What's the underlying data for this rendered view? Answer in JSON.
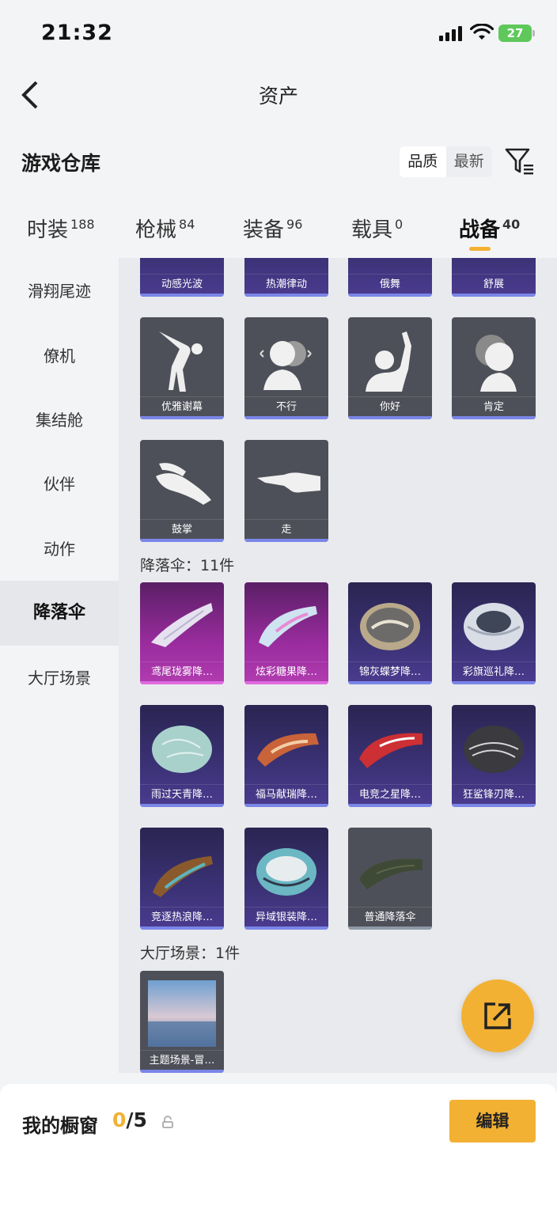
{
  "status": {
    "time": "21:32",
    "battery": "27"
  },
  "nav": {
    "title": "资产"
  },
  "section": {
    "title": "游戏仓库",
    "sort_quality": "品质",
    "sort_newest": "最新"
  },
  "tabs": [
    {
      "label": "时装",
      "count": "188"
    },
    {
      "label": "枪械",
      "count": "84"
    },
    {
      "label": "装备",
      "count": "96"
    },
    {
      "label": "载具",
      "count": "0"
    },
    {
      "label": "战备",
      "count": "40"
    }
  ],
  "sidebar": [
    "滑翔尾迹",
    "僚机",
    "集结舱",
    "伙伴",
    "动作",
    "降落伞",
    "大厅场景"
  ],
  "emotes_partial": [
    "动感光波",
    "热潮律动",
    "俄舞",
    "舒展"
  ],
  "emotes": [
    "优雅谢幕",
    "不行",
    "你好",
    "肯定",
    "鼓掌",
    "走"
  ],
  "parachute_group": {
    "title": "降落伞：11件"
  },
  "parachutes": [
    "鸢尾珑雾降…",
    "炫彩糖果降…",
    "锦灰蝶梦降…",
    "彩旗巡礼降…",
    "雨过天青降…",
    "福马献瑞降…",
    "电竞之星降…",
    "狂鲨锋刃降…",
    "竞逐热浪降…",
    "异域银装降…",
    "普通降落伞"
  ],
  "lobby_group": {
    "title": "大厅场景：1件"
  },
  "lobby": [
    "主题场景-冒…"
  ],
  "showcase": {
    "label": "我的橱窗",
    "current": "0",
    "total": "/5",
    "edit": "编辑"
  },
  "colors": {
    "accent": "#f2b133",
    "purple_card": "#3b3276",
    "pink_card": "#9a2c9e",
    "gray_card": "#4e5059"
  }
}
